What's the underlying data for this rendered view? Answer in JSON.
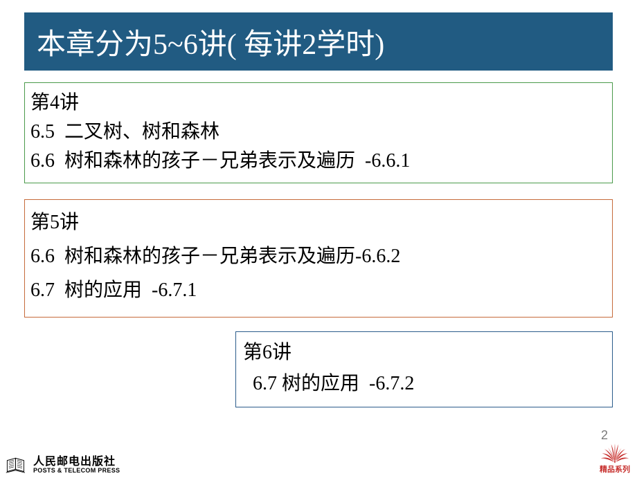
{
  "title": "本章分为5~6讲( 每讲2学时)",
  "box1": {
    "line1": "第4讲",
    "line2": "6.5  二叉树、树和森林",
    "line3": "6.6  树和森林的孩子－兄弟表示及遍历  -6.6.1"
  },
  "box2": {
    "line1": "第5讲",
    "line2": "6.6  树和森林的孩子－兄弟表示及遍历-6.6.2",
    "line3": "6.7  树的应用  -6.7.1"
  },
  "box3": {
    "line1": "第6讲",
    "line2": "  6.7 树的应用  -6.7.2"
  },
  "pageNumber": "2",
  "publisher": {
    "cn": "人民邮电出版社",
    "en": "POSTS & TELECOM PRESS"
  },
  "seriesLabel": "精品系列"
}
